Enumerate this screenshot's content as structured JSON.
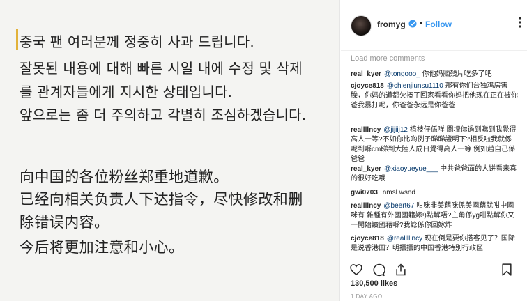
{
  "post": {
    "korean_lines": [
      "중국 팬 여러분께 정중히 사과 드립니다.",
      "잘못된 내용에 대해 빠른 시일 내에 수정 및 삭제",
      "를 관계자들에게 지시한 상태입니다.",
      "앞으로는 좀 더 주의하고 각별히 조심하겠습니다."
    ],
    "chinese_lines": [
      "向中国的各位粉丝郑重地道歉。",
      "已经向相关负责人下达指令，尽快修改和删",
      "除错误内容。",
      "今后将更加注意和小心。"
    ]
  },
  "header": {
    "username": "fromyg",
    "separator": "•",
    "follow_label": "Follow",
    "more_icon": "more-dots-icon"
  },
  "comments": {
    "load_more": "Load more comments",
    "items": [
      {
        "user": "real_kyer",
        "mention": "@tongooo_",
        "text": "你他妈脑残片吃多了吧"
      },
      {
        "user": "cjoyce818",
        "mention": "@chienjiunsu1110",
        "text": "那有你们台独鸡房害臊，你妈的道都欠揍了回家看看你妈把他现在正在被你爸我暴打呢，你爸爸永远是你爸爸"
      },
      {
        "user": "reallllncy",
        "mention": "@jijiij12",
        "text": "植枝仔係咩 問埋你過到睇到我覺得高人一等?不如你比啲例子睇睇證明下?相反啦我就係呢到喺cm睇到大陸人成日覺得高人一等 例如趙自己係爸爸"
      },
      {
        "user": "real_kyer",
        "mention": "@xiaoyueyue___",
        "text": "中共爸爸面的大饼看来真的很好吃哦"
      },
      {
        "user": "gwi0703",
        "mention": "",
        "text": "nmsl wsnd"
      },
      {
        "user": "reallllncy",
        "mention": "@beert67",
        "text": "咁咪非美藉咪係美國藉就咁中國咪有 雜種有外國國籍嫁!)點解唔?主角係yg咁點解你又一開始讀國藉喺?我諗係你回嫁炸"
      },
      {
        "user": "cjoyce818",
        "mention": "@realllllncy",
        "text": "现在倒是要你搭客见了？国际是说香港国？明摆摆的中国香港特别行政区"
      }
    ]
  },
  "actions": {
    "like_icon": "heart-icon",
    "comment_icon": "comment-icon",
    "share_icon": "share-icon",
    "save_icon": "bookmark-icon"
  },
  "likes": "130,500 likes",
  "time": "1 DAY AGO"
}
